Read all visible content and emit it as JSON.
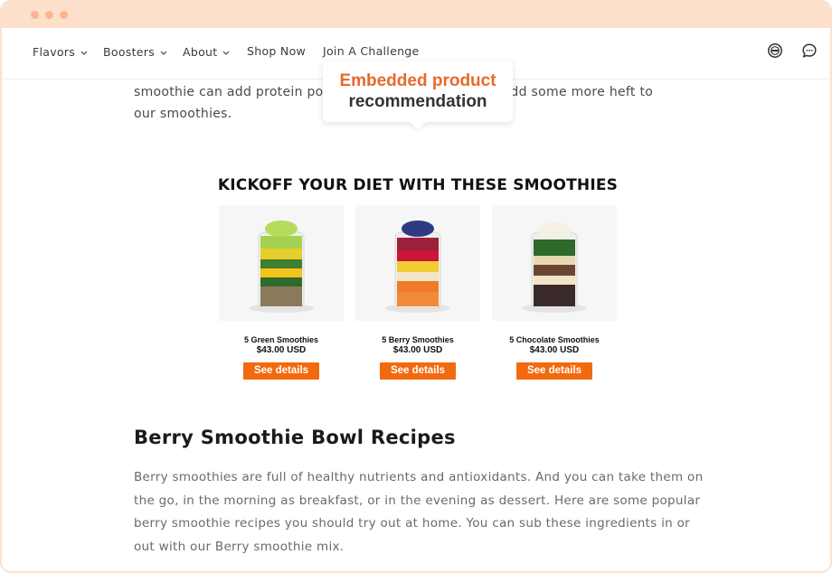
{
  "nav": {
    "items": [
      {
        "label": "Flavors",
        "has_dropdown": true
      },
      {
        "label": "Boosters",
        "has_dropdown": true
      },
      {
        "label": "About",
        "has_dropdown": true
      },
      {
        "label": "Shop Now",
        "has_dropdown": false
      },
      {
        "label": "Join A Challenge",
        "has_dropdown": false
      }
    ],
    "icons": [
      "account-icon",
      "chat-icon"
    ]
  },
  "intro": {
    "text": "smoothie can add protein powder to their smoothies to add some more heft to our smoothies."
  },
  "tooltip": {
    "line1": "Embedded product",
    "line2": "recommendation"
  },
  "recommendations": {
    "title": "KICKOFF YOUR DIET WITH THESE SMOOTHIES",
    "products": [
      {
        "name": "5 Green Smoothies",
        "price": "$43.00 USD",
        "button": "See details"
      },
      {
        "name": "5 Berry Smoothies",
        "price": "$43.00 USD",
        "button": "See details"
      },
      {
        "name": "5 Chocolate Smoothies",
        "price": "$43.00 USD",
        "button": "See details"
      }
    ]
  },
  "article": {
    "heading": "Berry Smoothie Bowl Recipes",
    "paragraph": "Berry smoothies are full of healthy nutrients and antioxidants. And you can take them on the go, in the morning as breakfast, or in the evening as dessert. Here are some popular berry smoothie recipes you should try out at home. You can sub these ingredients in or out with our Berry smoothie mix."
  },
  "colors": {
    "frame": "#fde0cc",
    "dots": "#fbb58f",
    "accent_orange": "#f26a10",
    "tooltip_highlight": "#e8692c"
  }
}
